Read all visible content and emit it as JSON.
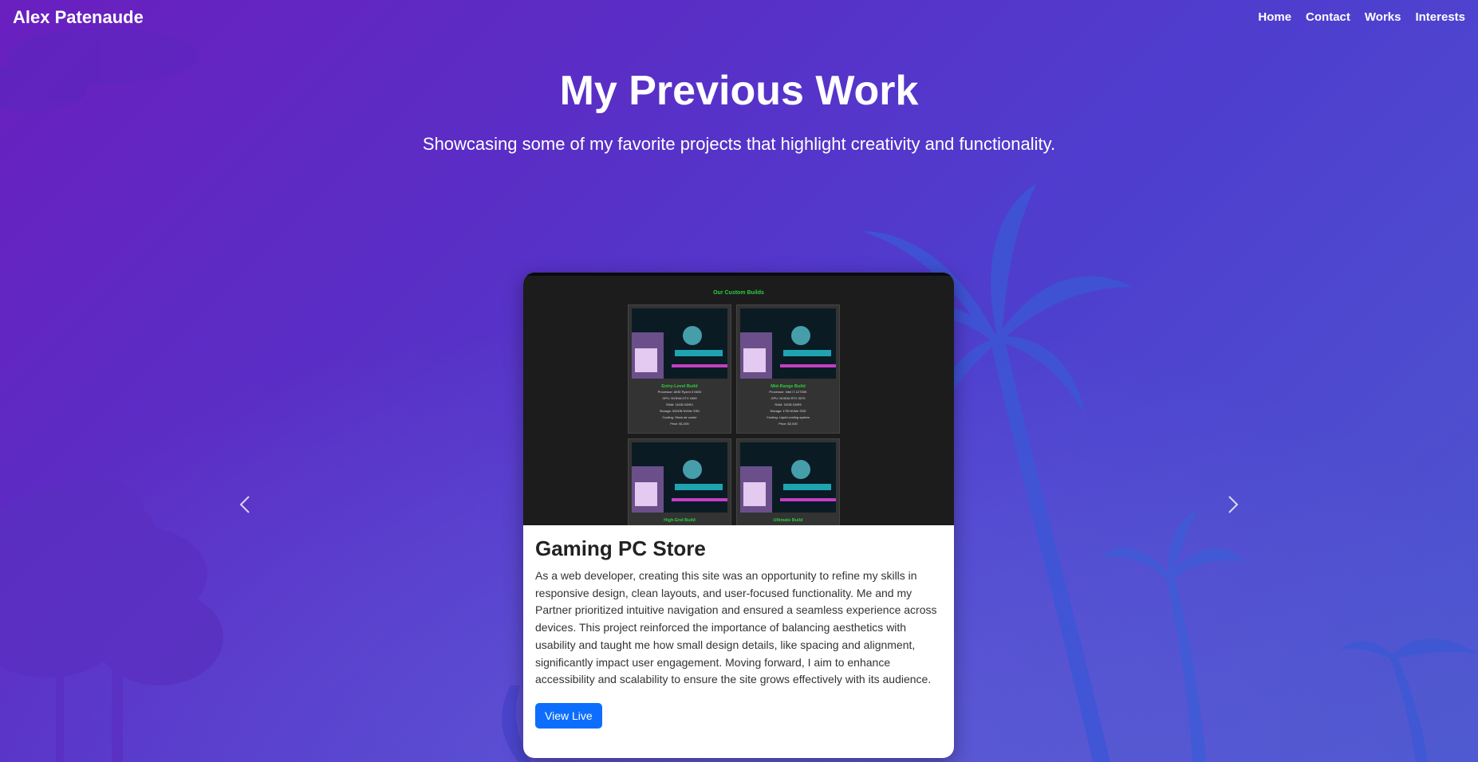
{
  "navbar": {
    "brand": "Alex Patenaude",
    "links": [
      {
        "label": "Home"
      },
      {
        "label": "Contact"
      },
      {
        "label": "Works"
      },
      {
        "label": "Interests"
      }
    ]
  },
  "hero": {
    "title": "My Previous Work",
    "subtitle": "Showcasing some of my favorite projects that highlight creativity and functionality."
  },
  "carousel": {
    "prev_icon": "chevron-left-icon",
    "next_icon": "chevron-right-icon",
    "active_slide": {
      "screenshot": {
        "heading": "Our Custom Builds",
        "builds": [
          {
            "name": "Entry-Level Build",
            "specs": [
              "Processor: AMD Ryzen 5 5600",
              "GPU: NVIDIA GTX 1650",
              "RAM: 16GB DDR4",
              "Storage: 500GB NVMe SSD",
              "Cooling: Stock air cooler",
              "Price: $1,000"
            ]
          },
          {
            "name": "Mid-Range Build",
            "specs": [
              "Processor: Intel i7-12700K",
              "GPU: NVIDIA RTX 3070",
              "RAM: 32GB DDR5",
              "Storage: 1TB NVMe SSD",
              "Cooling: Liquid cooling system",
              "Price: $2,000"
            ]
          },
          {
            "name": "High-End Build",
            "specs": []
          },
          {
            "name": "Ultimate Build",
            "specs": []
          }
        ]
      },
      "title": "Gaming PC Store",
      "description": "As a web developer, creating this site was an opportunity to refine my skills in responsive design, clean layouts, and user-focused functionality. Me and my Partner prioritized intuitive navigation and ensured a seamless experience across devices. This project reinforced the importance of balancing aesthetics with usability and taught me how small design details, like spacing and alignment, significantly impact user engagement. Moving forward, I aim to enhance accessibility and scalability to ensure the site grows effectively with its audience.",
      "button_label": "View Live"
    }
  },
  "colors": {
    "background_start": "#6a1fbf",
    "background_end": "#4d58cf",
    "palm_silhouette": "#3a55d8",
    "tree_silhouette": "#4a2fb8",
    "button": "#0d6efd",
    "build_name_green": "#2ecc40"
  }
}
